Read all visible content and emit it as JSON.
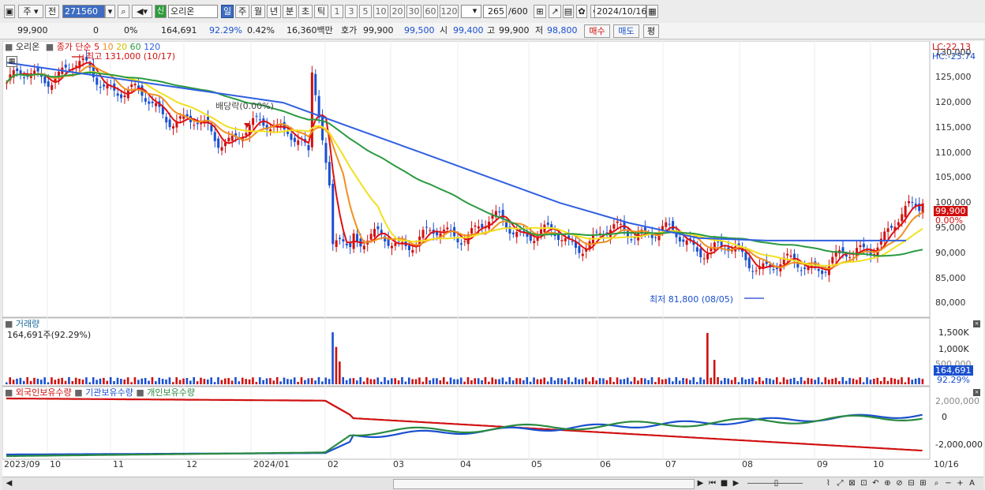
{
  "toolbar": {
    "market_label": "주",
    "prev_label": "전",
    "stock_code": "271560",
    "new_badge": "신",
    "stock_name": "오리온",
    "periods": [
      "일",
      "주",
      "월",
      "년",
      "분",
      "초",
      "틱"
    ],
    "intervals": [
      "1",
      "3",
      "5",
      "10",
      "20",
      "30",
      "60",
      "120"
    ],
    "count_value": "265",
    "count_total": "/600",
    "date_value": "2024/10/16"
  },
  "quote": {
    "price": "99,900",
    "change": "0",
    "change_rate": "0%",
    "volume": "164,691",
    "vol_ratio": "92.29%",
    "turnover": "0.42%",
    "amount": "16,360백만",
    "ask_label": "호가",
    "ask_value": "99,900",
    "bid_value": "99,500",
    "open_label": "시",
    "open_value": "99,400",
    "high_label": "고",
    "high_value": "99,900",
    "low_label": "저",
    "low_value": "98,800",
    "buy_label": "매수",
    "sell_label": "매도",
    "eval_label": "평"
  },
  "legend": {
    "name": "오리온",
    "ma_title": "종가 단순",
    "ma_periods": [
      "5",
      "10",
      "20",
      "60",
      "120"
    ],
    "high_note": "최고 131,000 (10/17)",
    "low_note": "최저 81,800 (08/05)",
    "dividend_note": "배당락(0.00%)",
    "lc": "LC:22.13",
    "hc": "HC:-23.74"
  },
  "price_tag": {
    "value": "99,900",
    "pct": "0.00%"
  },
  "volume_panel": {
    "title": "거래량",
    "value": "164,691주(92.29%)",
    "tag_value": "164,691",
    "tag_pct": "92.29%"
  },
  "holdings_panel": {
    "series": [
      "외국인보유수량",
      "기관보유수량",
      "개인보유수량"
    ],
    "ticks": [
      "2,000,000",
      "0",
      "-2,000,000"
    ]
  },
  "axes": {
    "price_ticks": [
      "130,000",
      "125,000",
      "120,000",
      "115,000",
      "110,000",
      "105,000",
      "100,000",
      "95,000",
      "90,000",
      "85,000",
      "80,000"
    ],
    "volume_ticks": [
      "1,500K",
      "1,000K",
      "500,000"
    ],
    "x_ticks": [
      "2023/09",
      "10",
      "11",
      "12",
      "2024/01",
      "02",
      "03",
      "04",
      "05",
      "06",
      "07",
      "08",
      "09",
      "10",
      "10/16"
    ]
  },
  "colors": {
    "up": "#d01010",
    "down": "#1a4fd0",
    "ma5": "#e01010",
    "ma10": "#f09020",
    "ma20": "#f2e020",
    "ma60": "#2a9a40",
    "ma120": "#3060e0"
  },
  "chart_data": {
    "type": "line",
    "title": "오리온",
    "x": [
      "2023/09",
      "10",
      "11",
      "12",
      "2024/01",
      "02",
      "03",
      "04",
      "05",
      "06",
      "07",
      "08",
      "09",
      "10"
    ],
    "series": [
      {
        "name": "종가",
        "values": [
          124000,
          127000,
          120000,
          113000,
          116000,
          92000,
          93000,
          96000,
          92000,
          95000,
          91000,
          87000,
          89000,
          99900
        ]
      },
      {
        "name": "120",
        "values": [
          128000,
          126000,
          124000,
          122000,
          120000,
          115000,
          110000,
          105000,
          100000,
          96000,
          93000,
          92500,
          92500,
          92500
        ]
      }
    ],
    "ylim": [
      80000,
      131000
    ],
    "high": {
      "value": 131000,
      "date": "10/17"
    },
    "low": {
      "value": 81800,
      "date": "08/05"
    }
  }
}
